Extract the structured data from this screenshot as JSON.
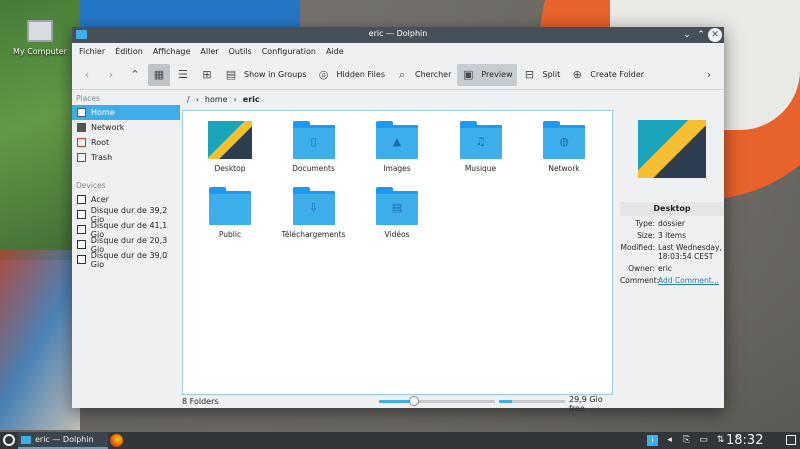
{
  "desktop": {
    "icon_label": "My Computer"
  },
  "window": {
    "title": "eric — Dolphin",
    "min_icon": "chevron-down-icon",
    "max_icon": "chevron-up-icon",
    "close_icon": "close-icon"
  },
  "menu": [
    "Fichier",
    "Édition",
    "Affichage",
    "Aller",
    "Outils",
    "Configuration",
    "Aide"
  ],
  "toolbar": {
    "show_in_groups": "Show in Groups",
    "hidden_files": "Hidden Files",
    "search": "Chercher",
    "preview": "Preview",
    "split": "Split",
    "create_folder": "Create Folder"
  },
  "sidebar": {
    "places_header": "Places",
    "places": [
      "Home",
      "Network",
      "Root",
      "Trash"
    ],
    "devices_header": "Devices",
    "devices": [
      "Acer",
      "Disque dur de 39,2 Gio",
      "Disque dur de 41,1 Gio",
      "Disque dur de 20,3 Gio",
      "Disque dur de 39,0 Gio"
    ]
  },
  "breadcrumb": {
    "root": "/",
    "home": "home",
    "current": "eric"
  },
  "files": [
    {
      "name": "Desktop",
      "kind": "thumbnail"
    },
    {
      "name": "Documents",
      "kind": "folder",
      "emblem": "document-icon"
    },
    {
      "name": "Images",
      "kind": "folder",
      "emblem": "image-icon"
    },
    {
      "name": "Musique",
      "kind": "folder",
      "emblem": "music-note-icon"
    },
    {
      "name": "Network",
      "kind": "folder",
      "emblem": "globe-icon"
    },
    {
      "name": "Public",
      "kind": "folder",
      "emblem": ""
    },
    {
      "name": "Téléchargements",
      "kind": "folder",
      "emblem": "download-icon"
    },
    {
      "name": "Vidéos",
      "kind": "folder",
      "emblem": "film-icon"
    }
  ],
  "status": {
    "count": "8 Folders",
    "free_space": "29,9 Gio free",
    "zoom_fraction": 0.3,
    "used_fraction": 0.2
  },
  "info": {
    "name": "Desktop",
    "type_k": "Type:",
    "type_v": "dossier",
    "size_k": "Size:",
    "size_v": "3 items",
    "modified_k": "Modified:",
    "modified_v": "Last Wednesday, 18:03:54 CEST",
    "owner_k": "Owner:",
    "owner_v": "eric",
    "comment_k": "Comment:",
    "comment_v": "Add Comment..."
  },
  "taskbar": {
    "task_label": "eric — Dolphin",
    "clock": "18:32"
  }
}
